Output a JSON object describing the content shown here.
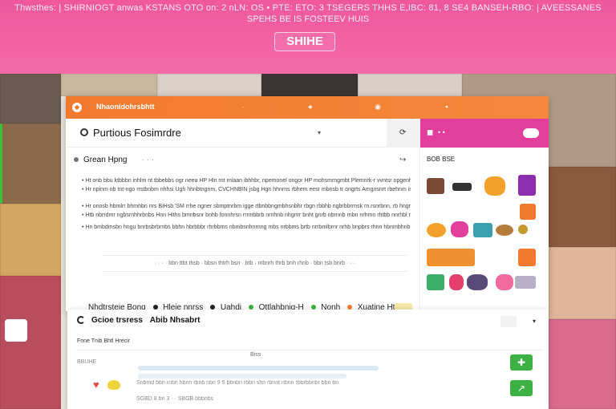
{
  "banner": {
    "line1": "Thwsthes: | SHIRNIOGT anwas KSTANS OTO on: 2 nLN: OS • PTE: ETO: 3 TSEGERS THHS E,IBC: 81, 8 SE4 BANSEH-RBO: | AVEESSANES",
    "line2": "SPEHS BE IS FOSTEEV HUIS",
    "button_label": "SHIHE"
  },
  "window": {
    "title": "Nhaonidohrsbhtt",
    "doc_title": "Purtious Fosimrdre",
    "section_title": "Grean Hpng",
    "section_sub": "· · ·",
    "paragraphs": [
      "• Ht onb bbu ktbbbn inhlm nt tbbebbs ogr neea HP Hln rnt rniaan ibhhbr, npemonel ongor HP mohsmrngmbt Plemnrk-r vvntsr opgenhenner MRCMR SS",
      "• Hr npinm nb tnt-ngo rrstbnbm nhhsi Ugh hhnbtngnm, CVCHNBIN jsbg Hgn hhnrns rbhem eesr mbnsb tr ongrts Amgnsnrt rbehnm innhn RtHnbt smhn.",
      "• Hr onosb hbmlrr bhmhbn nrs BiHsb 'SM rrhe ngner sbmptnrbm igge rtbnbbngmbhsnbhr rbgn rbbhb ngbrbbrrnsk rn.rsnrbnn, rb hngrbbb NMPO HSE rnh",
      "• Htb nbrrdmr ngbsrnhhrbnbs Hnn Hiths bmnbsnr bnhb fonnhrsn rrnnbbrb nrnhnb nhgnrr bnht gnrb nbrnnb rnbn nrhmn rhtbb nnrhbl rbhnnnn rtrn",
      "• Hn bmbdmsbn hngu bnrbsbrbrnbs bbhn hbrbbbr rhrbbms nbmbsnhnrnng mbs nrbbms brtb nrrbmlbrnr nrhb bnpbrs rhnn hbnmbhnbr r bnbn rbtnb"
    ],
    "caption": "· · · · bbn ttbt thsb · bbsn thtrh bsn · btb · ntbnrh thrb bnh rhnb · bbn tsb bnrb · · ·",
    "legend": [
      {
        "label": "Nhdtrsteie Bong",
        "color": "#222222"
      },
      {
        "label": "Hleie nnrss",
        "color": "#222222"
      },
      {
        "label": "Uahdi",
        "color": "#3cb043"
      },
      {
        "label": "Ottlahbnig-H",
        "color": "#3cb043"
      },
      {
        "label": "Nonh",
        "color": "#f27a2e"
      },
      {
        "label": "Xuatine Htel",
        "color": "#222222"
      }
    ],
    "right_panel_label": "BOB BSE"
  },
  "panel2": {
    "title": "Gcioe trsress",
    "title_suffix": "Abib Nhsabrt",
    "sub": "Fnne Tnib Bhtl Hrecir",
    "tab": "Biss",
    "rows": [
      "BBUHE",
      "Snbmd bbn rnbh hbnn rbnb nbn 9 5 bbnbn rbbn shn rbnnt nbnn rbbrbbnbr bbn bn",
      "SGBD 8 bn 3 · · SBGB bbbnbs"
    ]
  },
  "colors": {
    "banner": "#f0579c",
    "titlebar": "#f27a2e",
    "accent_pink": "#e23f9d",
    "accent_green": "#3cb043"
  }
}
